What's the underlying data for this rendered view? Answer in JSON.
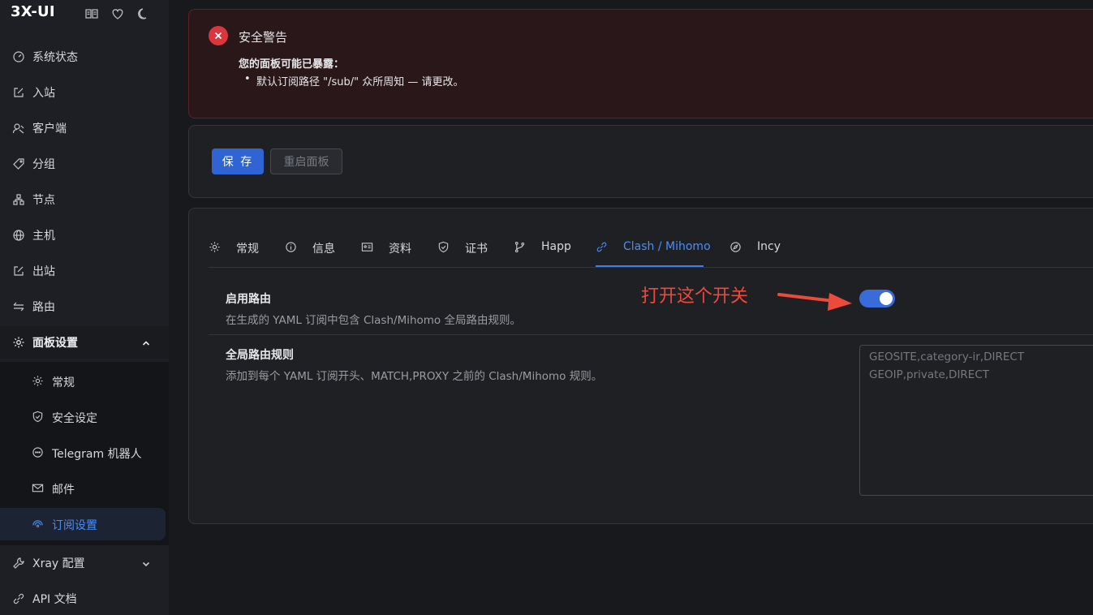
{
  "brand": {
    "title": "3X-UI",
    "icons": [
      "book-icon",
      "heart-icon",
      "moon-icon"
    ]
  },
  "sidebar": {
    "items": [
      {
        "label": "系统状态",
        "icon": "dashboard-icon"
      },
      {
        "label": "入站",
        "icon": "edit-icon"
      },
      {
        "label": "客户端",
        "icon": "users-icon"
      },
      {
        "label": "分组",
        "icon": "tag-icon"
      },
      {
        "label": "节点",
        "icon": "cluster-icon"
      },
      {
        "label": "主机",
        "icon": "globe-icon"
      },
      {
        "label": "出站",
        "icon": "edit-icon"
      },
      {
        "label": "路由",
        "icon": "swap-icon"
      },
      {
        "label": "面板设置",
        "icon": "gear-icon",
        "expanded": true
      }
    ],
    "submenu": [
      {
        "label": "常规",
        "icon": "gear-icon"
      },
      {
        "label": "安全设定",
        "icon": "shield-icon"
      },
      {
        "label": "Telegram 机器人",
        "icon": "chat-icon"
      },
      {
        "label": "邮件",
        "icon": "mail-icon"
      },
      {
        "label": "订阅设置",
        "icon": "rss-icon",
        "active": true
      }
    ],
    "bottom_items": [
      {
        "label": "Xray 配置",
        "icon": "wrench-icon"
      },
      {
        "label": "API 文档",
        "icon": "link-icon"
      }
    ]
  },
  "alert": {
    "title": "安全警告",
    "description": "您的面板可能已暴露：",
    "items": [
      "默认订阅路径 \"/sub/\" 众所周知 — 请更改。"
    ],
    "color": "#d9363e"
  },
  "actions": {
    "save": "保 存",
    "restart": "重启面板"
  },
  "tabs": [
    {
      "label": "常规",
      "icon": "gear-icon"
    },
    {
      "label": "信息",
      "icon": "info-icon"
    },
    {
      "label": "资料",
      "icon": "id-card-icon"
    },
    {
      "label": "证书",
      "icon": "shield-icon"
    },
    {
      "label": "Happ",
      "icon": "branch-icon"
    },
    {
      "label": "Clash / Mihomo",
      "icon": "link-icon",
      "active": true
    },
    {
      "label": "Incy",
      "icon": "compass-icon"
    }
  ],
  "routing": {
    "enable_title": "启用路由",
    "enable_desc": "在生成的 YAML 订阅中包含 Clash/Mihomo 全局路由规则。",
    "enabled": true,
    "rules_title": "全局路由规则",
    "rules_desc": "添加到每个 YAML 订阅开头、MATCH,PROXY 之前的 Clash/Mihomo 规则。",
    "rules_placeholder": [
      "GEOSITE,category-ir,DIRECT",
      "GEOIP,private,DIRECT"
    ]
  },
  "annotation": {
    "text": "打开这个开关",
    "color": "#ec4a3a"
  },
  "colors": {
    "accent": "#3063d4",
    "active_text": "#4a8ef5"
  }
}
